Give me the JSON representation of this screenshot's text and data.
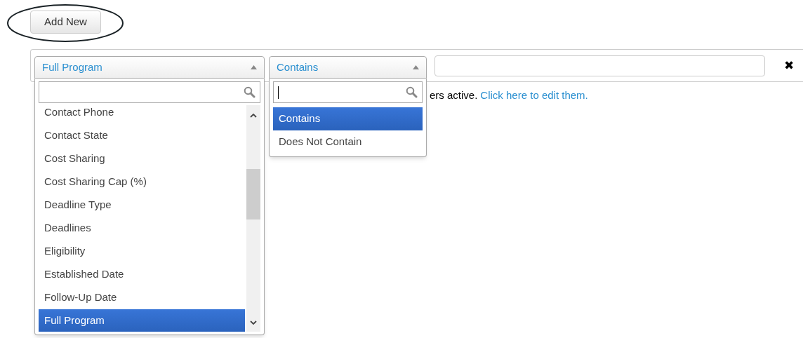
{
  "add_button": {
    "label": "Add New",
    "highlighted": true
  },
  "filter": {
    "field_select": {
      "value": "Full Program",
      "expanded": true,
      "options": [
        {
          "label": "Contact Phone",
          "selected": false
        },
        {
          "label": "Contact State",
          "selected": false
        },
        {
          "label": "Cost Sharing",
          "selected": false
        },
        {
          "label": "Cost Sharing Cap (%)",
          "selected": false
        },
        {
          "label": "Deadline Type",
          "selected": false
        },
        {
          "label": "Deadlines",
          "selected": false
        },
        {
          "label": "Eligibility",
          "selected": false
        },
        {
          "label": "Established Date",
          "selected": false
        },
        {
          "label": "Follow-Up Date",
          "selected": false
        },
        {
          "label": "Full Program",
          "selected": true
        }
      ]
    },
    "operator_select": {
      "value": "Contains",
      "expanded": true,
      "options": [
        {
          "label": "Contains",
          "selected": true
        },
        {
          "label": "Does Not Contain",
          "selected": false
        }
      ]
    },
    "remove": "✖"
  },
  "notice": {
    "text": "ers active.",
    "link": "Click here to edit them."
  }
}
